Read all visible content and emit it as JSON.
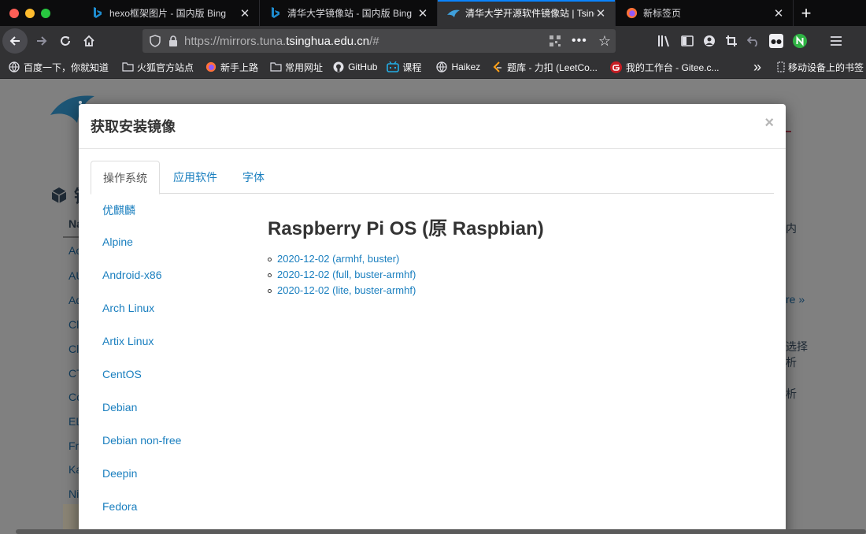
{
  "browser": {
    "tabs": [
      {
        "title": "hexo框架图片 - 国内版 Bing",
        "icon": "bing-icon",
        "active": false
      },
      {
        "title": "清华大学镜像站 - 国内版 Bing",
        "icon": "bing-icon",
        "active": false
      },
      {
        "title": "清华大学开源软件镜像站 | Tsinghua",
        "icon": "tuna-icon",
        "active": true
      },
      {
        "title": "新标签页",
        "icon": "firefox-icon",
        "active": false
      }
    ],
    "new_tab_label": "+",
    "url": {
      "prefix": "https://mirrors.tuna.",
      "domain": "tsinghua.edu.cn",
      "suffix": "/#"
    },
    "bookmarks": [
      {
        "label": "百度一下，你就知道",
        "icon": "globe-icon"
      },
      {
        "label": "火狐官方站点",
        "icon": "folder-icon"
      },
      {
        "label": "新手上路",
        "icon": "firefox-icon"
      },
      {
        "label": "常用网址",
        "icon": "folder-icon"
      },
      {
        "label": "GitHub",
        "icon": "github-icon"
      },
      {
        "label": "课程",
        "icon": "bilibili-icon"
      },
      {
        "label": "Haikez",
        "icon": "globe-icon"
      },
      {
        "label": "题库 - 力扣 (LeetCo...",
        "icon": "leetcode-icon"
      },
      {
        "label": "我的工作台 - Gitee.c...",
        "icon": "gitee-icon"
      }
    ],
    "bookmarks_overflow": "»",
    "mobile_bookmarks": "移动设备上的书签"
  },
  "background": {
    "partial_heading": "镜",
    "col_header": "Na",
    "row_fragments": [
      "Ao",
      "AU",
      "Ad",
      "Cl",
      "Cl",
      "CT",
      "Co",
      "EL",
      "Fr",
      "Ka",
      "Ni",
      "O"
    ],
    "right_fragments": [
      "内",
      "re »",
      "选择",
      "析",
      "析"
    ]
  },
  "modal": {
    "title": "获取安装镜像",
    "close": "×",
    "tabs": [
      "操作系统",
      "应用软件",
      "字体"
    ],
    "distros": [
      "优麒麟",
      "Alpine",
      "Android-x86",
      "Arch Linux",
      "Artix Linux",
      "CentOS",
      "Debian",
      "Debian non-free",
      "Deepin",
      "Fedora"
    ],
    "selected_title": "Raspberry Pi OS (原 Raspbian)",
    "downloads": [
      "2020-12-02 (armhf, buster)",
      "2020-12-02 (full, buster-armhf)",
      "2020-12-02 (lite, buster-armhf)"
    ]
  },
  "colors": {
    "link": "#1a7fbf",
    "tab_accent": "#0a84ff",
    "overlay": "#808080"
  }
}
